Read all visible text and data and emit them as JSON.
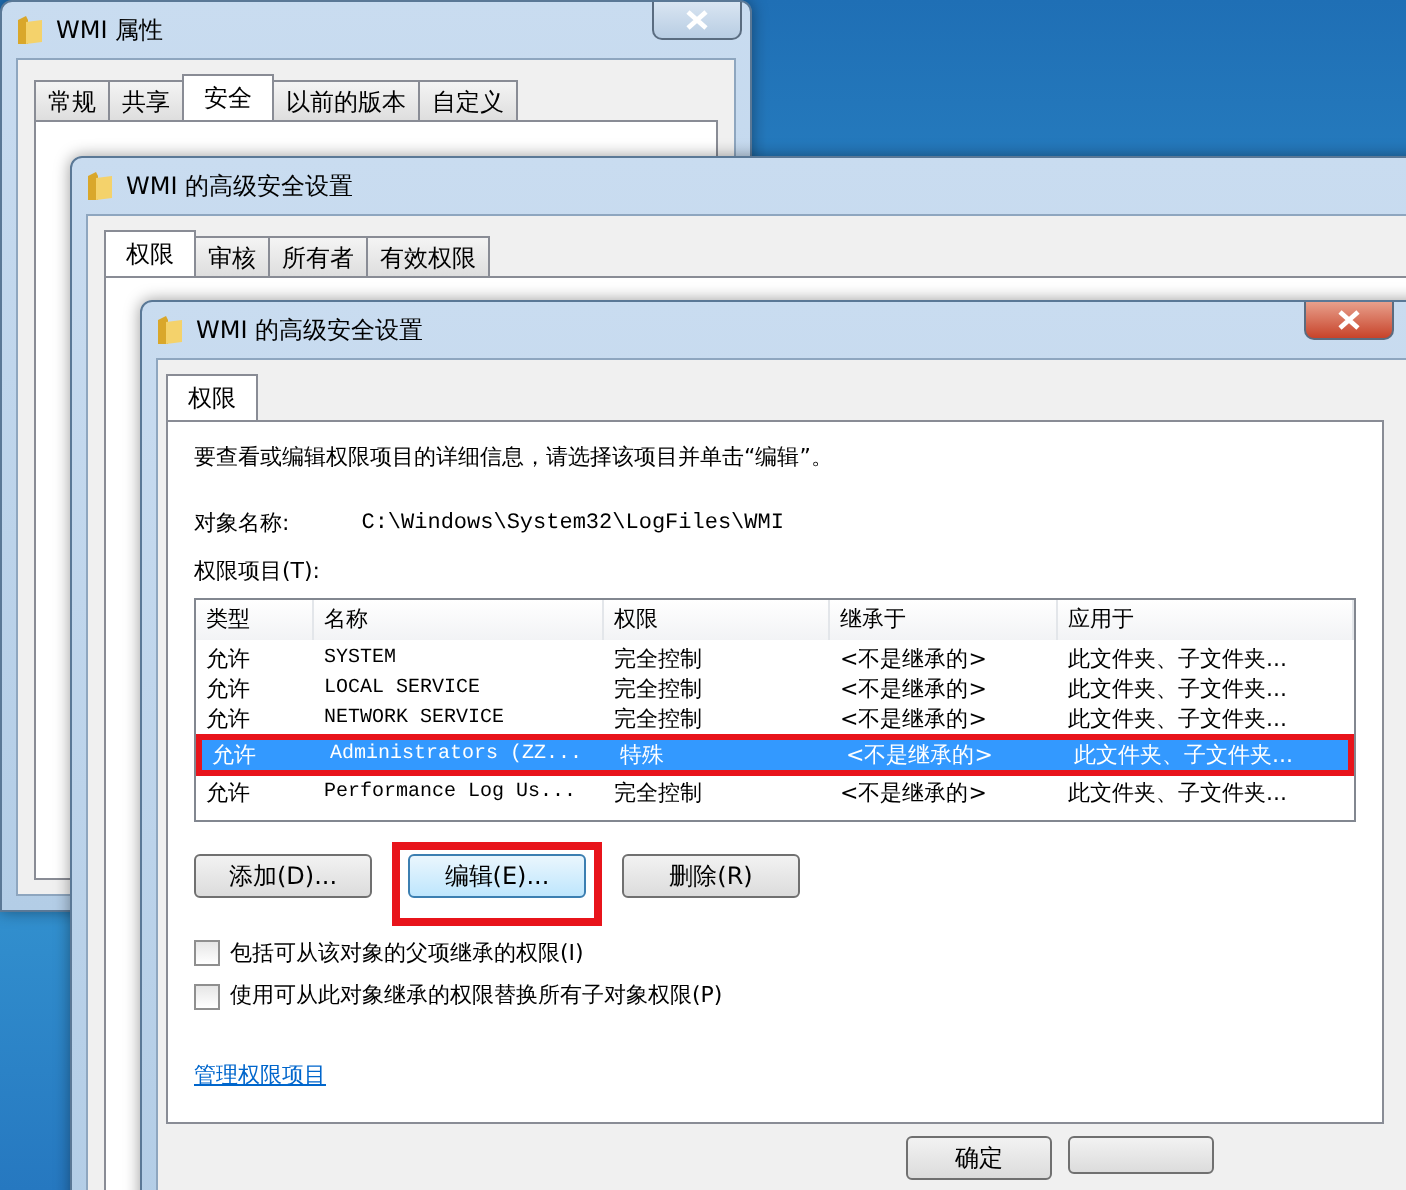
{
  "back_windows": [
    {
      "title": "WMI 属性",
      "tabs": [
        {
          "label": "常规",
          "selected": false
        },
        {
          "label": "共享",
          "selected": false
        },
        {
          "label": "安全",
          "selected": true
        },
        {
          "label": "以前的版本",
          "selected": false
        },
        {
          "label": "自定义",
          "selected": false
        }
      ]
    },
    {
      "title": "WMI 的高级安全设置",
      "tabs": [
        {
          "label": "权限",
          "selected": true
        },
        {
          "label": "审核",
          "selected": false
        },
        {
          "label": "所有者",
          "selected": false
        },
        {
          "label": "有效权限",
          "selected": false
        }
      ]
    }
  ],
  "dialog": {
    "title": "WMI 的高级安全设置",
    "tabs": [
      {
        "label": "权限",
        "selected": true
      }
    ],
    "instruction": "要查看或编辑权限项目的详细信息，请选择该项目并单击“编辑”。",
    "object_name_label": "对象名称:",
    "object_name_value": "C:\\Windows\\System32\\LogFiles\\WMI",
    "entries_label": "权限项目(T):",
    "table": {
      "columns": [
        "类型",
        "名称",
        "权限",
        "继承于",
        "应用于"
      ],
      "rows": [
        {
          "cells": [
            "允许",
            "SYSTEM",
            "完全控制",
            "<不是继承的>",
            "此文件夹、子文件夹..."
          ],
          "selected": false,
          "annotated": false
        },
        {
          "cells": [
            "允许",
            "LOCAL SERVICE",
            "完全控制",
            "<不是继承的>",
            "此文件夹、子文件夹..."
          ],
          "selected": false,
          "annotated": false
        },
        {
          "cells": [
            "允许",
            "NETWORK SERVICE",
            "完全控制",
            "<不是继承的>",
            "此文件夹、子文件夹..."
          ],
          "selected": false,
          "annotated": false
        },
        {
          "cells": [
            "允许",
            "Administrators (ZZ...",
            "特殊",
            "<不是继承的>",
            "此文件夹、子文件夹..."
          ],
          "selected": true,
          "annotated": true
        },
        {
          "cells": [
            "允许",
            "Performance Log Us...",
            "完全控制",
            "<不是继承的>",
            "此文件夹、子文件夹..."
          ],
          "selected": false,
          "annotated": false
        }
      ]
    },
    "buttons": [
      {
        "label": "添加(D)...",
        "hovered": false,
        "annotated": false
      },
      {
        "label": "编辑(E)...",
        "hovered": true,
        "annotated": true
      },
      {
        "label": "删除(R)",
        "hovered": false,
        "annotated": false
      }
    ],
    "checkboxes": [
      {
        "label": "包括可从该对象的父项继承的权限(I)",
        "checked": false
      },
      {
        "label": "使用可从此对象继承的权限替换所有子对象权限(P)",
        "checked": false
      }
    ],
    "link": "管理权限项目",
    "footer_buttons": [
      {
        "label": "确定"
      }
    ]
  }
}
